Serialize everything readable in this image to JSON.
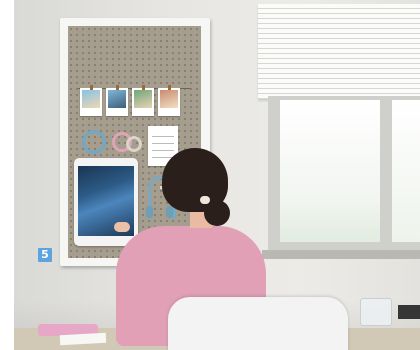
{
  "badge": {
    "number": "5",
    "color": "#5da4de"
  },
  "scene": {
    "wall_color": "#e7e6e2",
    "board_color": "#a59d8d",
    "sweater_color": "#e1a0b6",
    "headphones_color": "#78a9c0"
  }
}
